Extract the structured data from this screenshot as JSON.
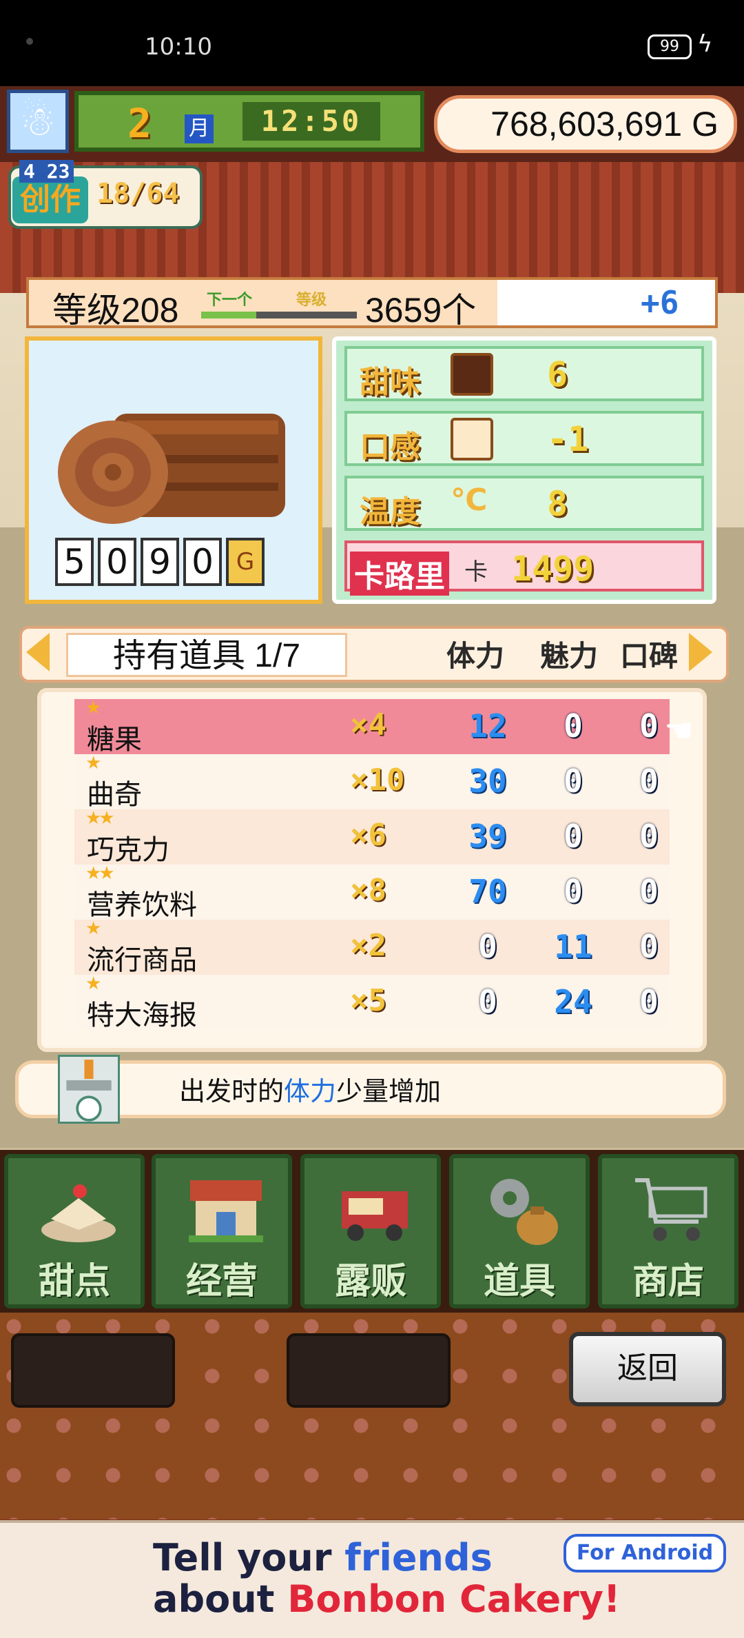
{
  "status_bar": {
    "time": "10:10",
    "battery": "99"
  },
  "header": {
    "month_number": "2",
    "month_label": "月",
    "clock": "12:50",
    "money": "768,603,691 G"
  },
  "create": {
    "sub_label": "4 23",
    "label": "创作",
    "count": "18/64"
  },
  "level": {
    "text": "等级208",
    "bar_left": "下一个",
    "bar_right": "等级",
    "count": "3659个",
    "plus": "+6"
  },
  "item_card": {
    "price_digits": [
      "5",
      "0",
      "9",
      "0"
    ],
    "currency": "G"
  },
  "stats": [
    {
      "label": "甜味",
      "value": "6",
      "icon": "chocolate-icon"
    },
    {
      "label": "口感",
      "value": "-1",
      "icon": "bread-icon"
    },
    {
      "label": "温度",
      "value": "8",
      "icon": "celsius-icon"
    }
  ],
  "calorie": {
    "label": "卡路里",
    "unit": "卡",
    "value": "1499"
  },
  "inventory": {
    "title": "持有道具 1/7",
    "columns": [
      "体力",
      "魅力",
      "口碑"
    ],
    "items": [
      {
        "stars": "★",
        "name": "糖果",
        "qty": "×4",
        "v1": "12",
        "v2": "0",
        "v3": "0",
        "selected": true
      },
      {
        "stars": "★",
        "name": "曲奇",
        "qty": "×10",
        "v1": "30",
        "v2": "0",
        "v3": "0",
        "selected": false
      },
      {
        "stars": "★★",
        "name": "巧克力",
        "qty": "×6",
        "v1": "39",
        "v2": "0",
        "v3": "0",
        "selected": false
      },
      {
        "stars": "★★",
        "name": "营养饮料",
        "qty": "×8",
        "v1": "70",
        "v2": "0",
        "v3": "0",
        "selected": false
      },
      {
        "stars": "★",
        "name": "流行商品",
        "qty": "×2",
        "v1": "0",
        "v2": "11",
        "v3": "0",
        "selected": false
      },
      {
        "stars": "★",
        "name": "特大海报",
        "qty": "×5",
        "v1": "0",
        "v2": "24",
        "v3": "0",
        "selected": false
      }
    ]
  },
  "description": {
    "prefix": "出发时的",
    "highlight": "体力",
    "suffix": "少量增加"
  },
  "menu": [
    {
      "label": "甜点",
      "icon": "cake-icon"
    },
    {
      "label": "经营",
      "icon": "shop-icon"
    },
    {
      "label": "露贩",
      "icon": "food-truck-icon"
    },
    {
      "label": "道具",
      "icon": "items-icon"
    },
    {
      "label": "商店",
      "icon": "cart-icon"
    }
  ],
  "back_button": "返回",
  "ad": {
    "line1_a": "Tell your ",
    "line1_b": "friends",
    "line2_a": "about ",
    "line2_b": "Bonbon Cakery!",
    "badge": "For Android"
  }
}
